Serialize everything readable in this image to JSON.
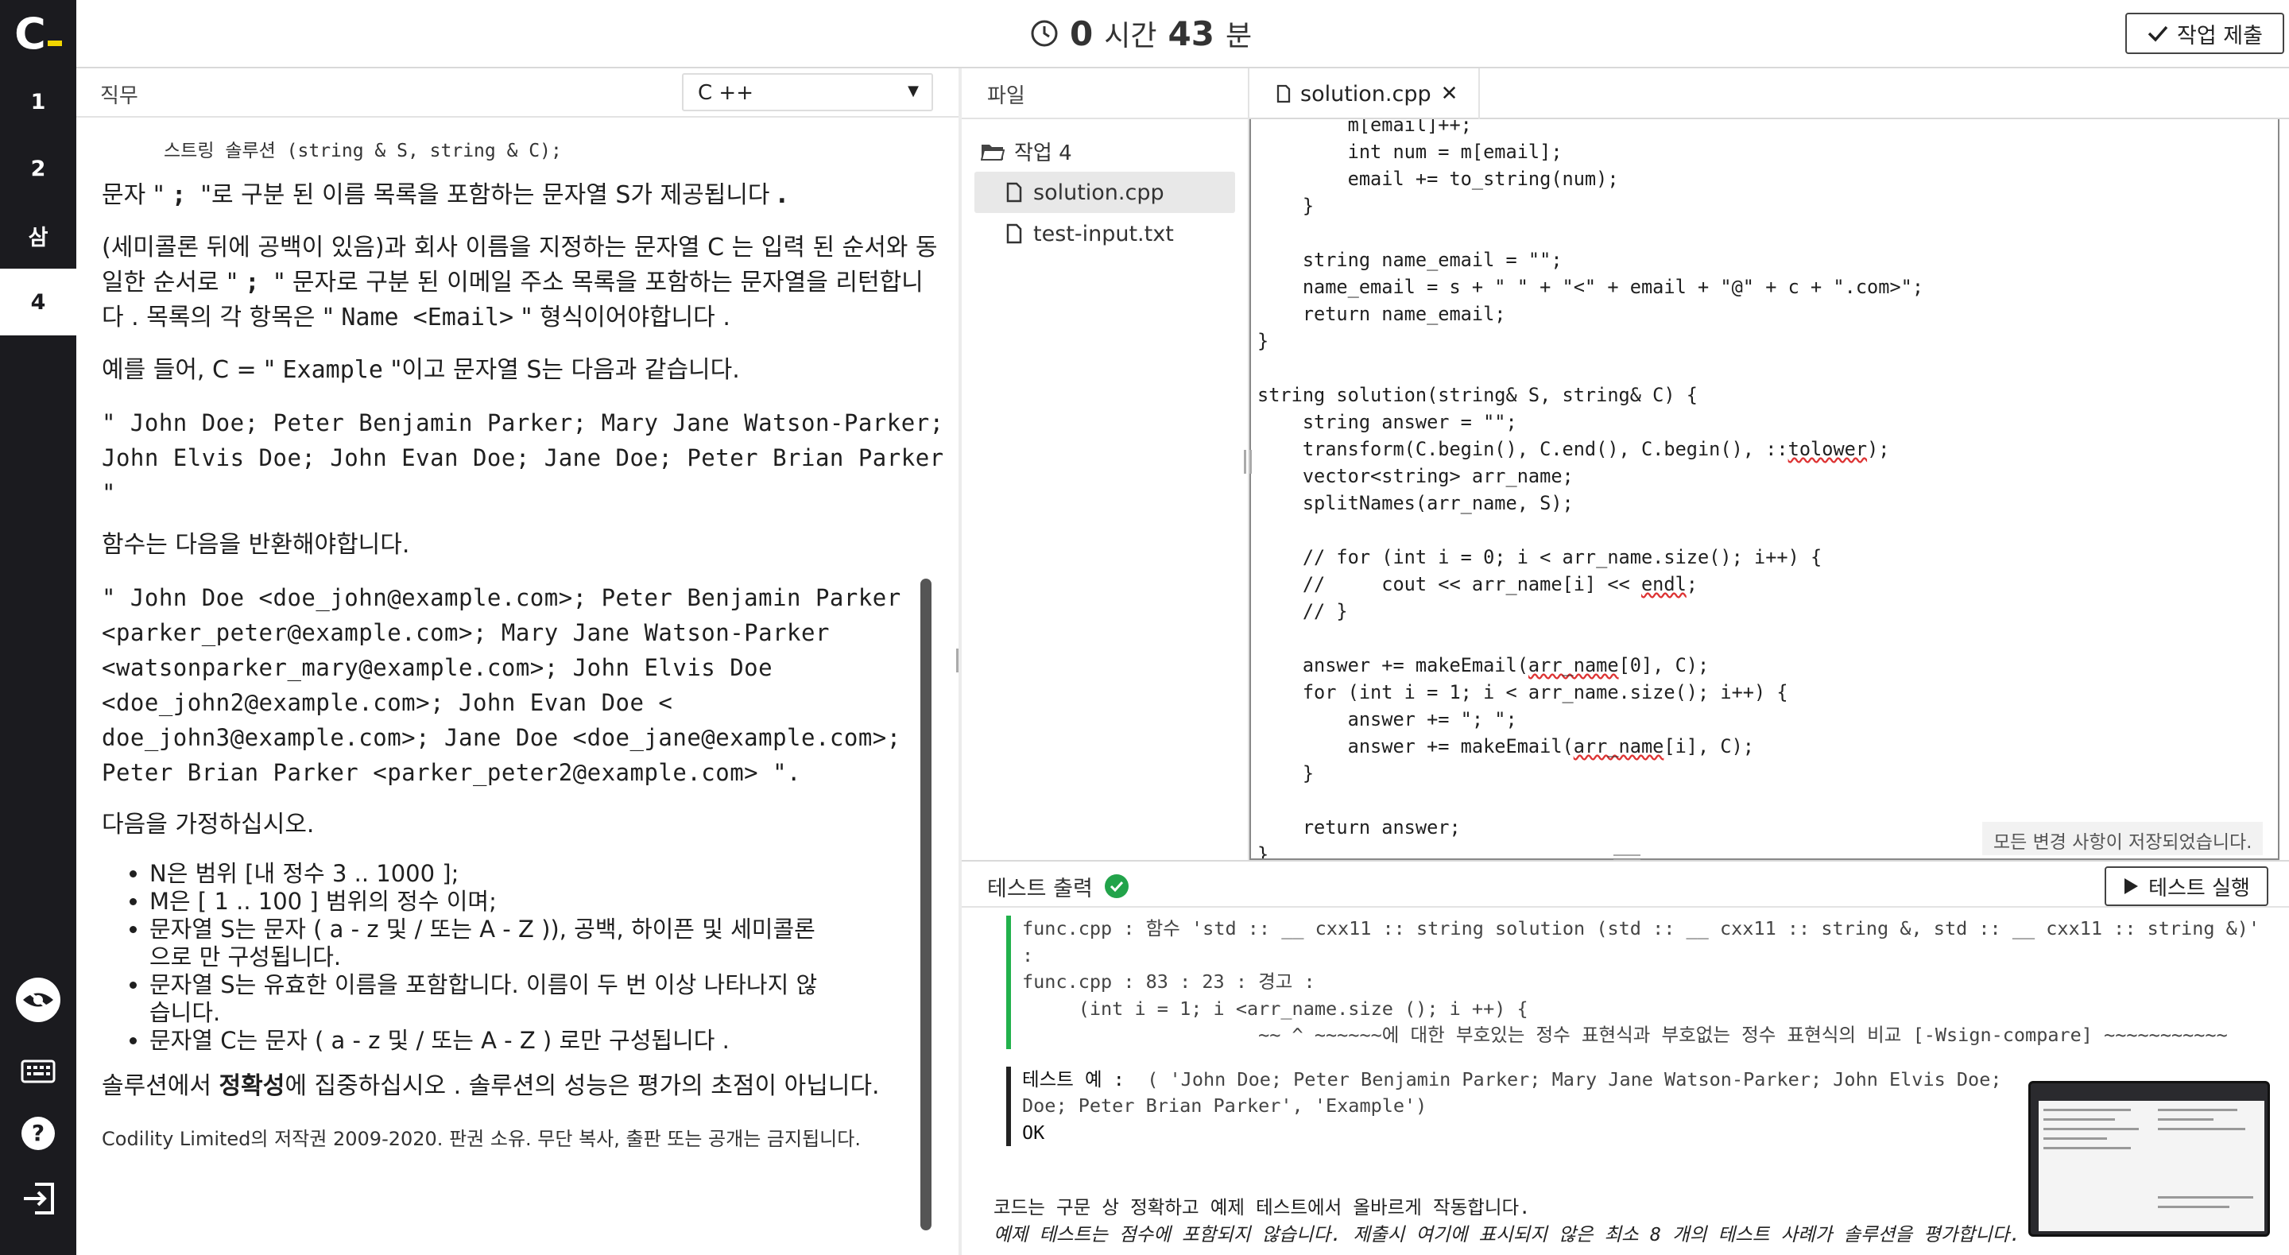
{
  "rail": {
    "logo_text": "C",
    "tasks": [
      "1",
      "2",
      "삼",
      "4"
    ],
    "active_task_index": 3,
    "icons": [
      "eye-icon",
      "keyboard-icon",
      "help-icon",
      "exit-icon"
    ]
  },
  "topbar": {
    "timer_hours": "0",
    "timer_hours_unit": "시간",
    "timer_minutes": "43",
    "timer_minutes_unit": "분",
    "submit_label": "작업 제출"
  },
  "problem": {
    "header_title": "직무",
    "language": "C ++",
    "signature": "스트링 솔루션 (string & S, string & C);",
    "para1_a": "문자 \" ",
    "para1_b": "; ",
    "para1_c": "\"로 구분 된 이름 목록을 포함하는 문자열 S가 제공됩니다 ",
    "para1_d": ".",
    "para2_a": "(세미콜론 뒤에 공백이 있음)과 회사 이름을 지정하는 문자열 C 는 입력 된 순서와 동일한 순서로 \" ",
    "para2_b": "; ",
    "para2_c": "\" 문자로 구분 된 이메일 주소 목록을 포함하는 문자열을 리턴합니다 . 목록의 각 항목은 \" ",
    "para2_d": "Name <Email>",
    "para2_e": " \" 형식이어야합니다 .",
    "para3_a": "예를 들어, C = \" ",
    "para3_b": "Example",
    "para3_c": " \"이고 문자열 S는 다음과 같습니다.",
    "example_input": "\" John Doe; Peter Benjamin Parker; Mary Jane Watson-Parker; John Elvis Doe; John Evan Doe; Jane Doe; Peter Brian Parker \"",
    "return_intro": "함수는 다음을 반환해야합니다.",
    "example_output": "\" John Doe <doe_john@example.com>; Peter Benjamin Parker <parker_peter@example.com>; Mary Jane Watson-Parker <watsonparker_mary@example.com>; John Elvis Doe <doe_john2@example.com>; John Evan Doe < doe_john3@example.com>; Jane Doe <doe_jane@example.com>; Peter Brian Parker <parker_peter2@example.com> \".",
    "assume_intro": "다음을 가정하십시오.",
    "assumptions": [
      "N은 범위 [내 정수 3 .. 1000 ];",
      "M은 [ 1 .. 100 ] 범위의 정수 이며;",
      "문자열 S는 문자 ( a - z 및 / 또는 A - Z )), 공백, 하이픈 및 세미콜론으로 만 구성됩니다.",
      "문자열 S는 유효한 이름을 포함합니다. 이름이 두 번 이상 나타나지 않습니다.",
      "문자열 C는 문자 ( a - z 및 / 또는 A - Z ) 로만 구성됩니다 ."
    ],
    "focus_a": "솔루션에서 ",
    "focus_b": "정확성",
    "focus_c": "에 집중하십시오 . 솔루션의 성능은 평가의 초점이 아닙니다.",
    "copyright": "Codility Limited의 저작권 2009-2020. 판권 소유. 무단 복사, 출판 또는 공개는 금지됩니다."
  },
  "files": {
    "header": "파일",
    "folder": "작업 4",
    "items": [
      "solution.cpp",
      "test-input.txt"
    ],
    "active_index": 0
  },
  "editor": {
    "tab_label": "solution.cpp",
    "saved_status": "모든 변경 사항이 저장되었습니다.",
    "code_lines": [
      "        m[email]++;",
      "        int num = m[email];",
      "        email += to_string(num);",
      "    }",
      "",
      "    string name_email = \"\";",
      "    name_email = s + \" \" + \"<\" + email + \"@\" + c + \".com>\";",
      "    return name_email;",
      "}",
      "",
      "string solution(string& S, string& C) {",
      "    string answer = \"\";",
      "    transform(C.begin(), C.end(), C.begin(), ::tolower);",
      "    vector<string> arr_name;",
      "    splitNames(arr_name, S);",
      "",
      "    // for (int i = 0; i < arr_name.size(); i++) {",
      "    //     cout << arr_name[i] << endl;",
      "    // }",
      "",
      "    answer += makeEmail(arr_name[0], C);",
      "    for (int i = 1; i < arr_name.size(); i++) {",
      "        answer += \"; \";",
      "        answer += makeEmail(arr_name[i], C);",
      "    }",
      "",
      "    return answer;",
      "}"
    ]
  },
  "tests": {
    "header": "테스트 출력",
    "status": "passed",
    "run_label": "테스트 실행",
    "log_lines": [
      "func.cpp : 함수 'std :: __ cxx11 :: string solution (std :: __ cxx11 :: string &, std :: __ cxx11 :: string &)'",
      ":",
      "func.cpp : 83 : 23 : 경고 :",
      "     (int i = 1; i <arr_name.size (); i ++) {",
      "                     ~~ ^ ~~~~~~에 대한 부호있는 정수 표현식과 부호없는 정수 표현식의 비교 [-Wsign-compare] ~~~~~~~~~~~"
    ],
    "example_label": "테스트 예 :",
    "example_value": "  ( 'John Doe; Peter Benjamin Parker; Mary Jane Watson-Parker; John Elvis Doe;",
    "example_value2": "Doe; Peter Brian Parker', 'Example')",
    "example_result": "OK",
    "summary1": "코드는 구문 상 정확하고 예제 테스트에서 올바르게 작동합니다.",
    "summary2": "예제 테스트는 점수에 포함되지 않습니다. 제출시 여기에 표시되지 않은 최소 8 개의 테스트 사례가 솔루션을 평가합니다."
  },
  "colors": {
    "rail_bg": "#1b1b1f",
    "accent_yellow": "#f2d600",
    "success_green": "#22a34a"
  }
}
